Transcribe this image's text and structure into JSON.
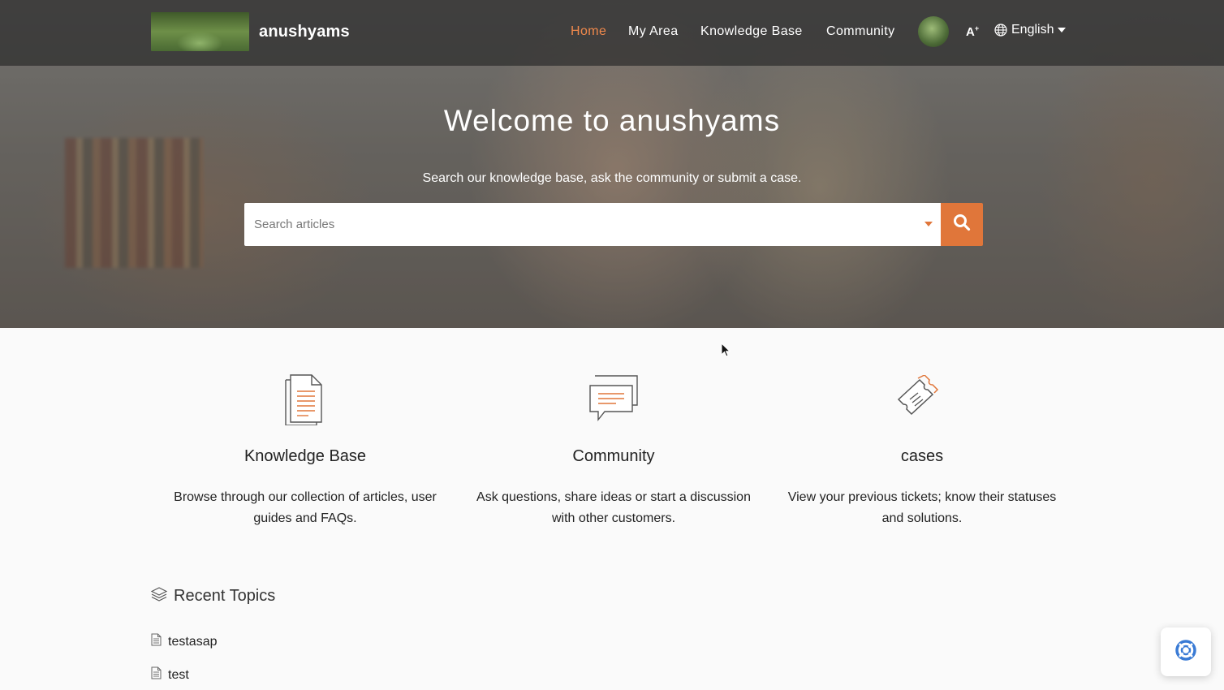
{
  "navbar": {
    "brand": "anushyams",
    "links": [
      {
        "label": "Home",
        "active": true
      },
      {
        "label": "My Area",
        "active": false
      },
      {
        "label": "Knowledge Base",
        "active": false
      },
      {
        "label": "Community",
        "active": false
      }
    ],
    "font_size_icon": "A",
    "language": "English",
    "icons": [
      "logo-image",
      "avatar",
      "font-size-icon",
      "globe-icon",
      "chevron-down-icon"
    ]
  },
  "hero": {
    "title": "Welcome to anushyams",
    "subtitle": "Search our knowledge base, ask the community or submit a case.",
    "search": {
      "placeholder": "Search articles",
      "value": ""
    }
  },
  "features": [
    {
      "title": "Knowledge Base",
      "description": "Browse through our collection of articles, user guides and FAQs.",
      "icon": "document-icon"
    },
    {
      "title": "Community",
      "description": "Ask questions, share ideas or start a discussion with other customers.",
      "icon": "chat-bubbles-icon"
    },
    {
      "title": "cases",
      "description": "View your previous tickets; know their statuses and solutions.",
      "icon": "ticket-icon"
    }
  ],
  "recent_topics": {
    "heading": "Recent Topics",
    "items": [
      {
        "label": "testasap"
      },
      {
        "label": "test"
      }
    ]
  },
  "colors": {
    "accent": "#e0763a",
    "nav_active": "#f0894c",
    "help_icon": "#3a7bd5"
  }
}
